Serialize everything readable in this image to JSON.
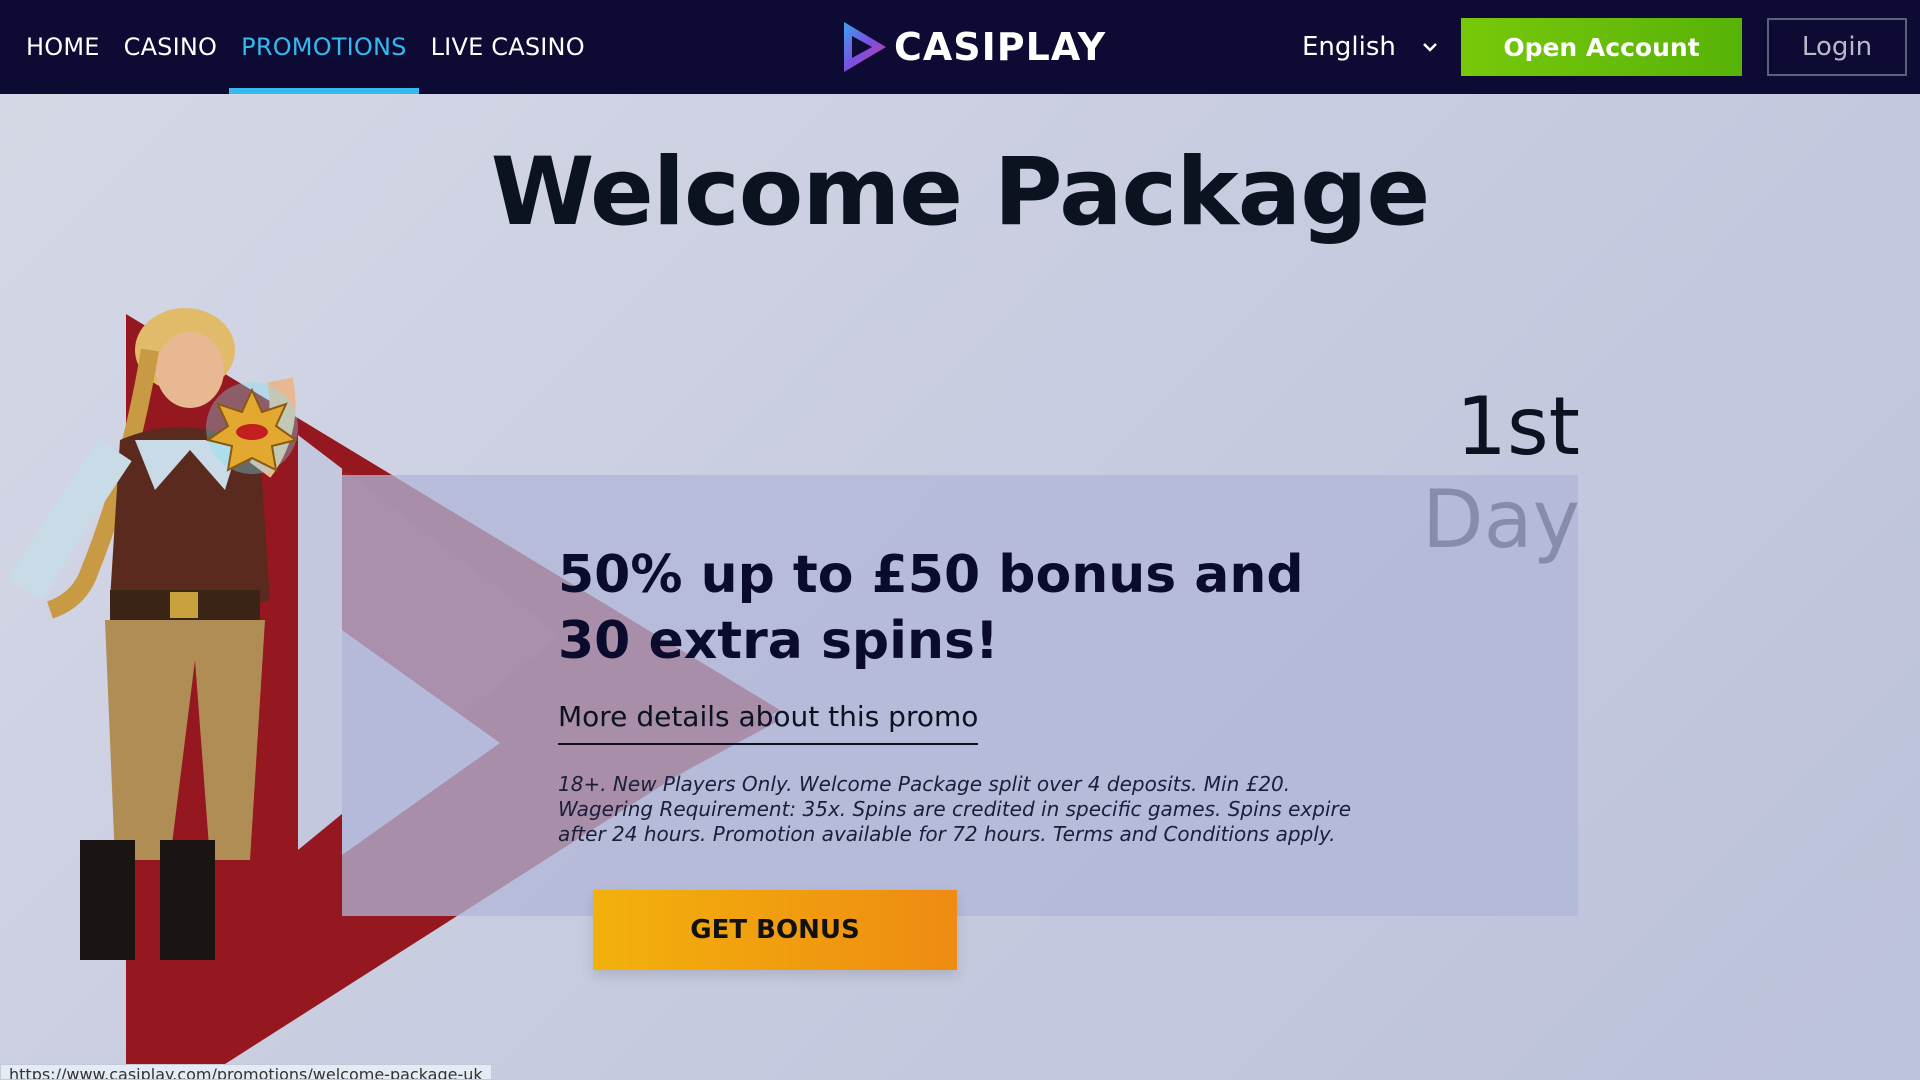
{
  "header": {
    "nav": [
      {
        "label": "HOME",
        "active": false
      },
      {
        "label": "CASINO",
        "active": false
      },
      {
        "label": "PROMOTIONS",
        "active": true
      },
      {
        "label": "LIVE CASINO",
        "active": false
      }
    ],
    "logo_text": "CASIPLAY",
    "language": "English",
    "open_account_label": "Open Account",
    "login_label": "Login"
  },
  "main": {
    "title": "Welcome Package",
    "day_label": "1st Day",
    "promo": {
      "headline": "50% up to £50 bonus and 30 extra spins!",
      "details_link": "More details about this promo",
      "terms": "18+. New Players Only. Welcome Package split over 4 deposits. Min £20. Wagering Requirement: 35x. Spins are credited in specific games. Spins expire after 24 hours. Promotion available for 72 hours. Terms and Conditions apply.",
      "cta_label": "GET BONUS"
    }
  },
  "status_bar": {
    "url": "https://www.casiplay.com/promotions/welcome-package-uk"
  },
  "colors": {
    "header_bg": "#0d0b33",
    "nav_active": "#35b9ef",
    "open_account": "#6bbf0a",
    "cta_start": "#f2b10c",
    "cta_end": "#ef8b12",
    "accent_red": "#9c1a22"
  },
  "icons": {
    "logo": "play-triangle-icon",
    "language_chevron": "chevron-down-icon",
    "character": "adventurer-character-illustration",
    "amulet": "eye-of-horus-amulet-icon"
  }
}
